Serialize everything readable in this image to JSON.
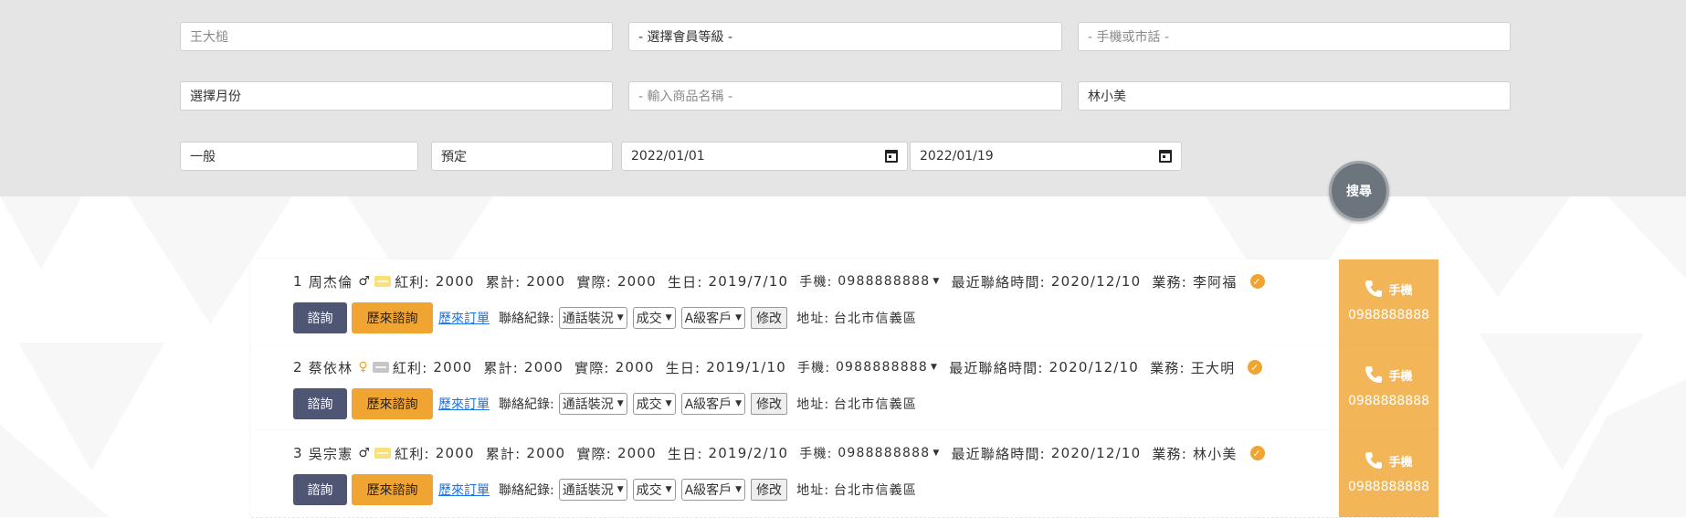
{
  "filters": {
    "name": "王大槌",
    "member_level": "- 選擇會員等級 -",
    "phone": "- 手機或市話 -",
    "month": "選擇月份",
    "product": "- 輸入商品名稱 -",
    "salesperson": "林小美",
    "type": "一般",
    "order_type": "預定",
    "date_from": "2022/01/01",
    "date_to": "2022/01/19"
  },
  "search_label": "搜尋",
  "common": {
    "bonus_label": "紅利:",
    "total_label": "累計:",
    "actual_label": "實際:",
    "birthday_label": "生日:",
    "mobile_label": "手機:",
    "last_contact_label": "最近聯絡時間:",
    "sales_label": "業務:",
    "consult_label": "諮詢",
    "history_consult_label": "歷來諮詢",
    "history_orders_label": "歷來訂單",
    "contact_log_label": "聯絡紀錄:",
    "status_option": "通話裝況",
    "result_option": "成交",
    "level_option": "A級客戶",
    "modify_label": "修改",
    "address_label": "地址:",
    "phone_panel_label": "手機"
  },
  "members": [
    {
      "index": "1",
      "name": "周杰倫",
      "gender": "♂",
      "bonus": "2000",
      "total": "2000",
      "actual": "2000",
      "birthday": "2019/7/10",
      "mobile": "0988888888",
      "last_contact": "2020/12/10",
      "sales": "李阿福",
      "address": "台北市信義區"
    },
    {
      "index": "2",
      "name": "蔡依林",
      "gender": "♀",
      "bonus": "2000",
      "total": "2000",
      "actual": "2000",
      "birthday": "2019/1/10",
      "mobile": "0988888888",
      "last_contact": "2020/12/10",
      "sales": "王大明",
      "address": "台北市信義區"
    },
    {
      "index": "3",
      "name": "吳宗憲",
      "gender": "♂",
      "bonus": "2000",
      "total": "2000",
      "actual": "2000",
      "birthday": "2019/2/10",
      "mobile": "0988888888",
      "last_contact": "2020/12/10",
      "sales": "林小美",
      "address": "台北市信義區"
    }
  ],
  "colors": {
    "filter_bg": "#e5e5e5",
    "accent_orange": "#f0a532",
    "phone_panel": "#f2b659",
    "dark_button": "#4f5674",
    "search_button": "#6c757d"
  }
}
